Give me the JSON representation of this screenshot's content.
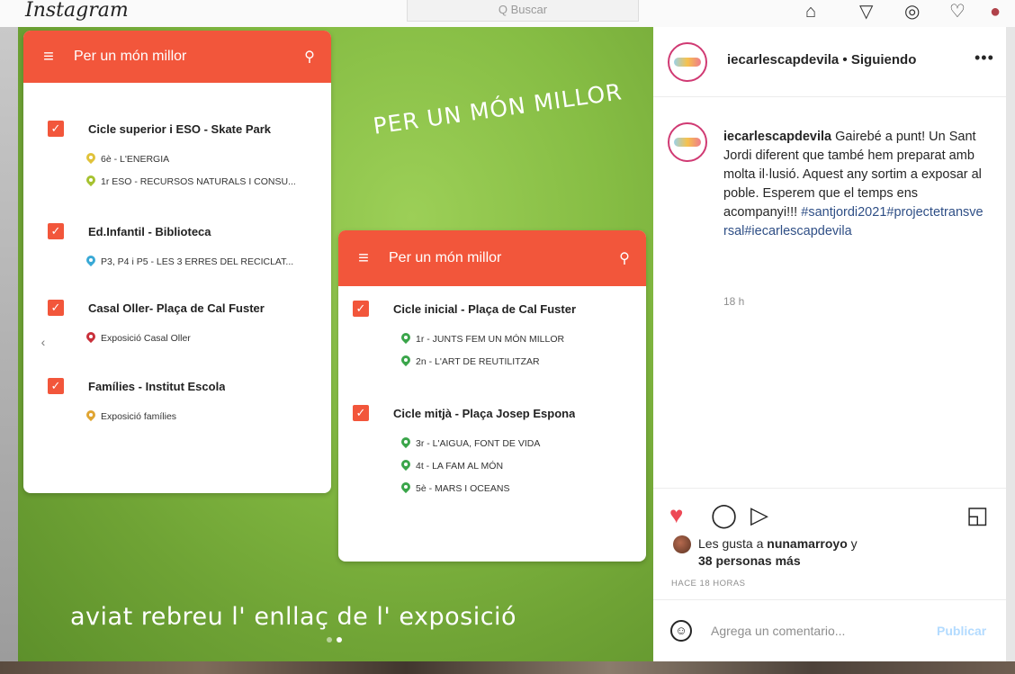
{
  "topbar": {
    "logo": "Instagram",
    "search_placeholder": "Q Buscar",
    "nav_icons": [
      "home-icon",
      "direct-icon",
      "explore-icon",
      "activity-icon",
      "profile-icon"
    ]
  },
  "post_image": {
    "title": "PER UN MÓN MILLOR",
    "caption": "aviat rebreu l' enllaç de l' exposició",
    "carousel_index": 2,
    "carousel_count": 2,
    "card_left": {
      "header_title": "Per un món millor",
      "groups": [
        {
          "name": "Cicle superior i ESO - Skate Park",
          "items": [
            {
              "text": "6è - L'ENERGIA",
              "pin_color": "#e0c23a"
            },
            {
              "text": "1r ESO - RECURSOS NATURALS I CONSU...",
              "pin_color": "#a6c230"
            }
          ]
        },
        {
          "name": "Ed.Infantil - Biblioteca",
          "items": [
            {
              "text": "P3, P4 i P5 - LES 3 ERRES DEL RECICLAT...",
              "pin_color": "#39a9d6"
            }
          ]
        },
        {
          "name": "Casal Oller- Plaça de Cal Fuster",
          "items": [
            {
              "text": "Exposició Casal Oller",
              "pin_color": "#c9303a"
            }
          ]
        },
        {
          "name": "Famílies - Institut Escola",
          "items": [
            {
              "text": "Exposició famílies",
              "pin_color": "#e0a532"
            }
          ]
        }
      ]
    },
    "card_right": {
      "header_title": "Per un món millor",
      "groups": [
        {
          "name": "Cicle inicial - Plaça de Cal Fuster",
          "items": [
            {
              "text": "1r - JUNTS FEM UN MÓN MILLOR",
              "pin_color": "#3aa54a"
            },
            {
              "text": "2n - L'ART DE REUTILITZAR",
              "pin_color": "#3aa54a"
            }
          ]
        },
        {
          "name": "Cicle mitjà - Plaça Josep Espona",
          "items": [
            {
              "text": "3r - L'AIGUA, FONT DE VIDA",
              "pin_color": "#3aa54a"
            },
            {
              "text": "4t - LA FAM AL MÓN",
              "pin_color": "#3aa54a"
            },
            {
              "text": "5è - MARS I OCEANS",
              "pin_color": "#3aa54a"
            }
          ]
        }
      ]
    }
  },
  "sidebar": {
    "username": "iecarlescapdevila",
    "separator": " • ",
    "following_label": "Siguiendo",
    "more_label": "•••",
    "comment": {
      "user": "iecarlescapdevila",
      "text": " Gairebé a punt! Un Sant Jordi diferent que també hem preparat amb molta il·lusió. Aquest any sortim a exposar al poble. Esperem que el temps ens acompanyi!!! ",
      "hashtags": "#santjordi2021#projectetransversal#iecarlescapdevila",
      "time": "18 h"
    },
    "likes": {
      "prefix": "Les gusta a ",
      "user": "nunamarroyo",
      "middle": " y",
      "others": "38 personas más"
    },
    "posted_ago": "HACE 18 HORAS",
    "comment_placeholder": "Agrega un comentario...",
    "publish_label": "Publicar"
  }
}
